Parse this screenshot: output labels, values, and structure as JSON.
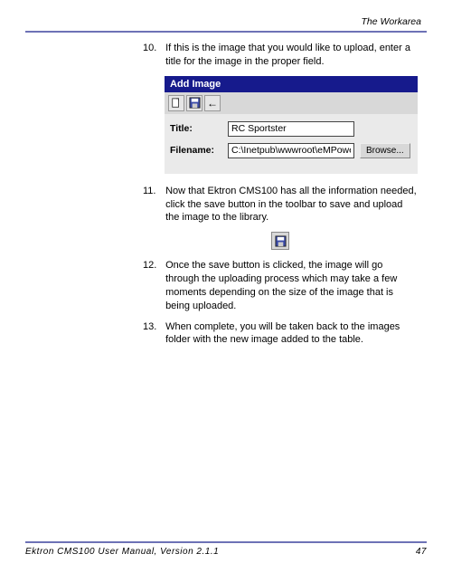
{
  "header": {
    "section_title": "The Workarea"
  },
  "steps": [
    {
      "num": "10.",
      "text": "If this is the image that you would like to upload, enter a title for the image in the proper field."
    },
    {
      "num": "11.",
      "text": "Now that Ektron CMS100 has all the information needed, click the save button in the toolbar to save and upload the image to the library."
    },
    {
      "num": "12.",
      "text": "Once the save button is clicked, the image will go through the uploading process which may take a few moments depending on the size of the image that is being uploaded."
    },
    {
      "num": "13.",
      "text": "When complete, you will be taken back to the images folder with the new image added to the table."
    }
  ],
  "dialog": {
    "title": "Add Image",
    "fields": {
      "title_label": "Title:",
      "title_value": "RC Sportster",
      "filename_label": "Filename:",
      "filename_value": "C:\\Inetpub\\wwwroot\\eMPowerSamp",
      "browse_label": "Browse..."
    }
  },
  "footer": {
    "manual_title": "Ektron CMS100 User Manual, Version 2.1.1",
    "page_number": "47"
  }
}
